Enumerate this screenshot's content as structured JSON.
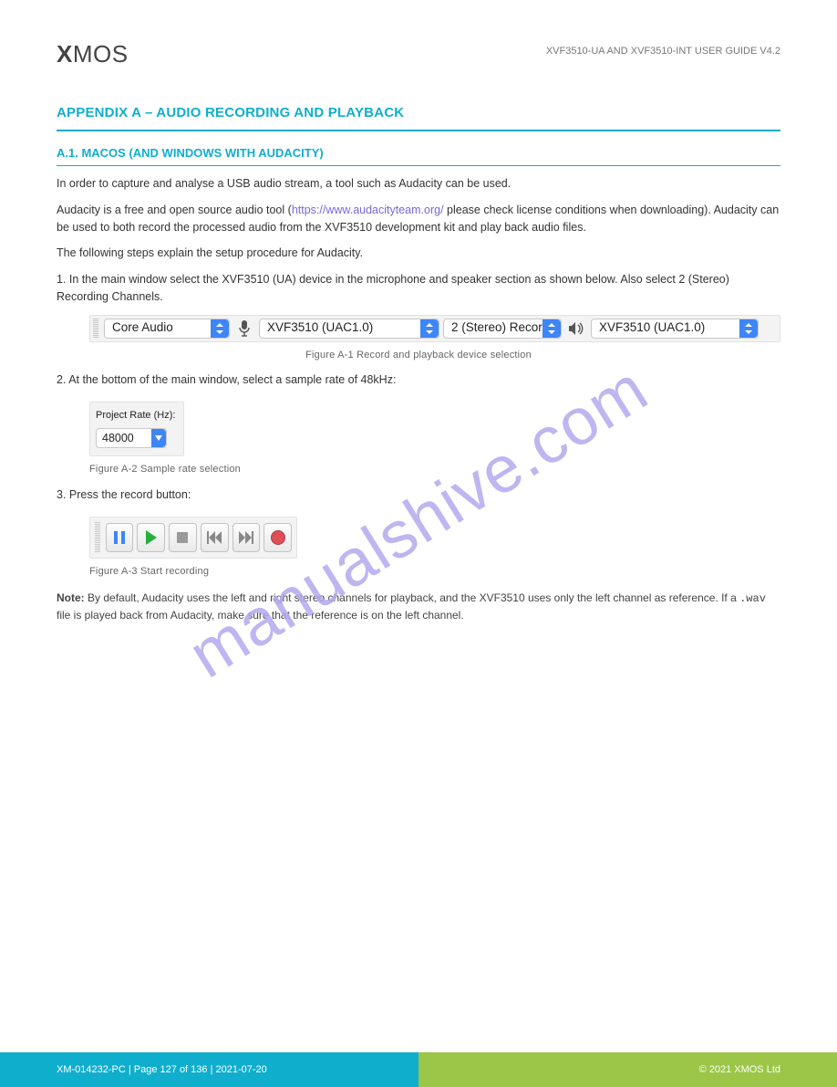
{
  "header": {
    "logo_prefix": "X",
    "logo_rest": "MOS",
    "top_right": "XVF3510-UA AND XVF3510-INT USER GUIDE V4.2"
  },
  "section": {
    "h1": "APPENDIX A – AUDIO RECORDING AND PLAYBACK",
    "h2": "A.1. MACOS (AND WINDOWS WITH AUDACITY)",
    "intro_a": "In order to capture and analyse a USB audio stream, a tool such as Audacity can be used.",
    "intro_b_a": "Audacity is a free and open source audio tool (",
    "intro_b_link": "https://www.audacityteam.org/",
    "intro_b_c": " please check license conditions when downloading). Audacity can be used to both record the processed audio from the XVF3510 development kit and play back audio files.",
    "intro_c": "The following steps explain the setup procedure for Audacity.",
    "step1": "1. In the main window select the XVF3510 (UA) device in the microphone and speaker section as shown below. Also select 2 (Stereo) Recording Channels.",
    "step2": "2. At the bottom of the main window, select a sample rate of 48kHz:",
    "step3": "3. Press the record button:",
    "note_lead": "Note:",
    "note_body": " By default, Audacity uses the left and right stereo channels for playback, and the XVF3510 uses only the left channel as reference. If a ",
    "note_mono": ".wav",
    "note_tail": " file is played back from Audacity, make sure that the reference is on the left channel."
  },
  "fig1": {
    "host": "Core Audio",
    "rec": "XVF3510 (UAC1.0)",
    "ch": "2 (Stereo) Recor...",
    "play": "XVF3510 (UAC1.0)",
    "caption": "Figure A-1 Record and playback device selection"
  },
  "fig2": {
    "label": "Project Rate (Hz):",
    "value": "48000",
    "caption": "Figure A-2 Sample rate selection"
  },
  "fig3": {
    "caption": "Figure A-3 Start recording"
  },
  "watermark": "manualshive.com",
  "footer": {
    "left": "XM-014232-PC | Page 127 of 136 | 2021-07-20",
    "right": "© 2021 XMOS Ltd"
  }
}
